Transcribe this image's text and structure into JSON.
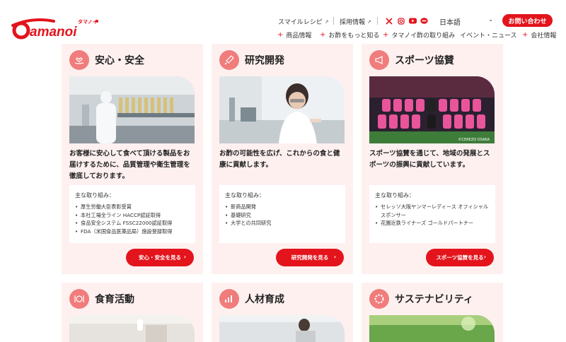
{
  "header": {
    "logo_text": "Tamanoi",
    "logo_kana": "タマノイ",
    "util_links": [
      {
        "label": "スマイルレシピ",
        "icon": "external-link-icon"
      },
      {
        "label": "採用情報",
        "icon": "external-link-icon"
      }
    ],
    "social_icons": [
      "x-icon",
      "instagram-icon",
      "youtube-icon",
      "line-icon"
    ],
    "language": {
      "label": "日本語",
      "icon": "chevron-down-icon"
    },
    "contact_label": "お問い合わせ",
    "nav": [
      {
        "label": "商品情報"
      },
      {
        "label": "お酢をもっと知る"
      },
      {
        "label": "タマノイ酢の取り組み"
      },
      {
        "label": "イベント・ニュース"
      },
      {
        "label": "会社情報"
      }
    ]
  },
  "colors": {
    "accent": "#e3141c",
    "card_bg": "#fff0f0",
    "icon_bg": "#f07c7c"
  },
  "cards": [
    {
      "icon": "heart-hand-icon",
      "title": "安心・安全",
      "desc": "お客様に安心して食べて頂ける製品をお届けするために、品質管理や衛生管理を徹底しております。",
      "panel_title": "主な取り組み：",
      "items": [
        "厚生労働大臣表彰受賞",
        "本社工場全ライン HACCP認証取得",
        "食品安全システム FSSC22000認証取得",
        "FDA（米国食品医薬品局）施設登録取得"
      ],
      "button": "安心・安全を見る",
      "photo": "factory-worker-photo"
    },
    {
      "icon": "pipette-icon",
      "title": "研究開発",
      "desc": "お酢の可能性を広げ、これからの食と健康に貢献します。",
      "panel_title": "主な取り組み：",
      "items": [
        "新商品開発",
        "基礎研究",
        "大学との共同研究"
      ],
      "button": "研究開発を見る",
      "photo": "lab-researcher-photo"
    },
    {
      "icon": "megaphone-icon",
      "title": "スポーツ協賛",
      "desc": "スポーツ協賛を通じて、地域の発展とスポーツの振興に貢献しています。",
      "panel_title": "主な取り組み：",
      "items": [
        "セレッソ大阪ヤンマーレディース オフィシャルスポンサー",
        "花園近鉄ライナーズ ゴールドパートナー"
      ],
      "button": "スポーツ協賛を見る",
      "photo": "team-photo",
      "photo_caption": "©CEREZO OSAKA"
    },
    {
      "icon": "plate-cutlery-icon",
      "title": "食育活動",
      "photo": "classroom-photo"
    },
    {
      "icon": "growth-chart-icon",
      "title": "人材育成",
      "photo": "seminar-photo"
    },
    {
      "icon": "sdgs-icon",
      "title": "サステナビリティ",
      "photo": "nature-photo"
    }
  ]
}
